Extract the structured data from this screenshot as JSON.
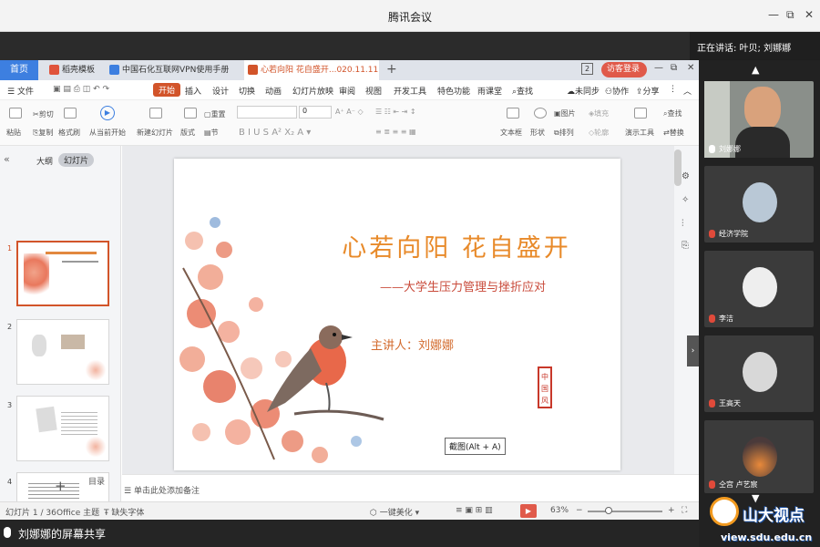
{
  "window": {
    "title": "腾讯会议"
  },
  "speaking": "正在讲话: 叶贝; 刘娜娜",
  "tabs": {
    "home": "首页",
    "items": [
      "稻壳模板",
      "中国石化互联网VPN使用手册",
      "心若向阳 花自盛开...020.11.11"
    ],
    "login": "访客登录"
  },
  "menu": {
    "file": "文件",
    "items": [
      "开始",
      "插入",
      "设计",
      "切换",
      "动画",
      "幻灯片放映",
      "审阅",
      "视图",
      "开发工具",
      "特色功能",
      "雨课堂"
    ],
    "search": "查找",
    "sync": "未同步",
    "collab": "协作",
    "share": "分享"
  },
  "ribbon": {
    "paste": "粘贴",
    "cut": "剪切",
    "copy": "复制",
    "format": "格式刷",
    "from_start": "从当前开始",
    "new_slide": "新建幻灯片",
    "layout": "版式",
    "section": "节",
    "reset": "重置",
    "font_size": "0",
    "textbox": "文本框",
    "shape": "形状",
    "picture": "图片",
    "fill": "填充",
    "arrange": "排列",
    "outline": "轮廓",
    "presenter": "演示工具",
    "find": "查找",
    "replace": "替换"
  },
  "panel": {
    "outline": "大纲",
    "slides": "幻灯片",
    "numbers": [
      "1",
      "2",
      "3",
      "4"
    ],
    "add": "+"
  },
  "slide": {
    "title": "心若向阳 花自盛开",
    "subtitle": "——大学生压力管理与挫折应对",
    "presenter": "主讲人：刘娜娜",
    "seal": "中国风",
    "tooltip": "截图(Alt + A)"
  },
  "thumb4": {
    "heading": "目录"
  },
  "notes": "单击此处添加备注",
  "status": {
    "slide": "幻灯片 1 / 36",
    "theme": "Office 主题",
    "font": "缺失字体",
    "beautify": "一键美化",
    "zoom": "63%"
  },
  "share_label": "刘娜娜的屏幕共享",
  "participants": [
    {
      "name": "刘娜娜"
    },
    {
      "name": "经济学院"
    },
    {
      "name": "李洁"
    },
    {
      "name": "王高天"
    },
    {
      "name": "仝宫 卢艺宸"
    }
  ],
  "watermark": {
    "brand": "山大视点",
    "url": "view.sdu.edu.cn"
  },
  "colors": {
    "accent": "#d2542a",
    "home_tab": "#3d7fe0"
  }
}
